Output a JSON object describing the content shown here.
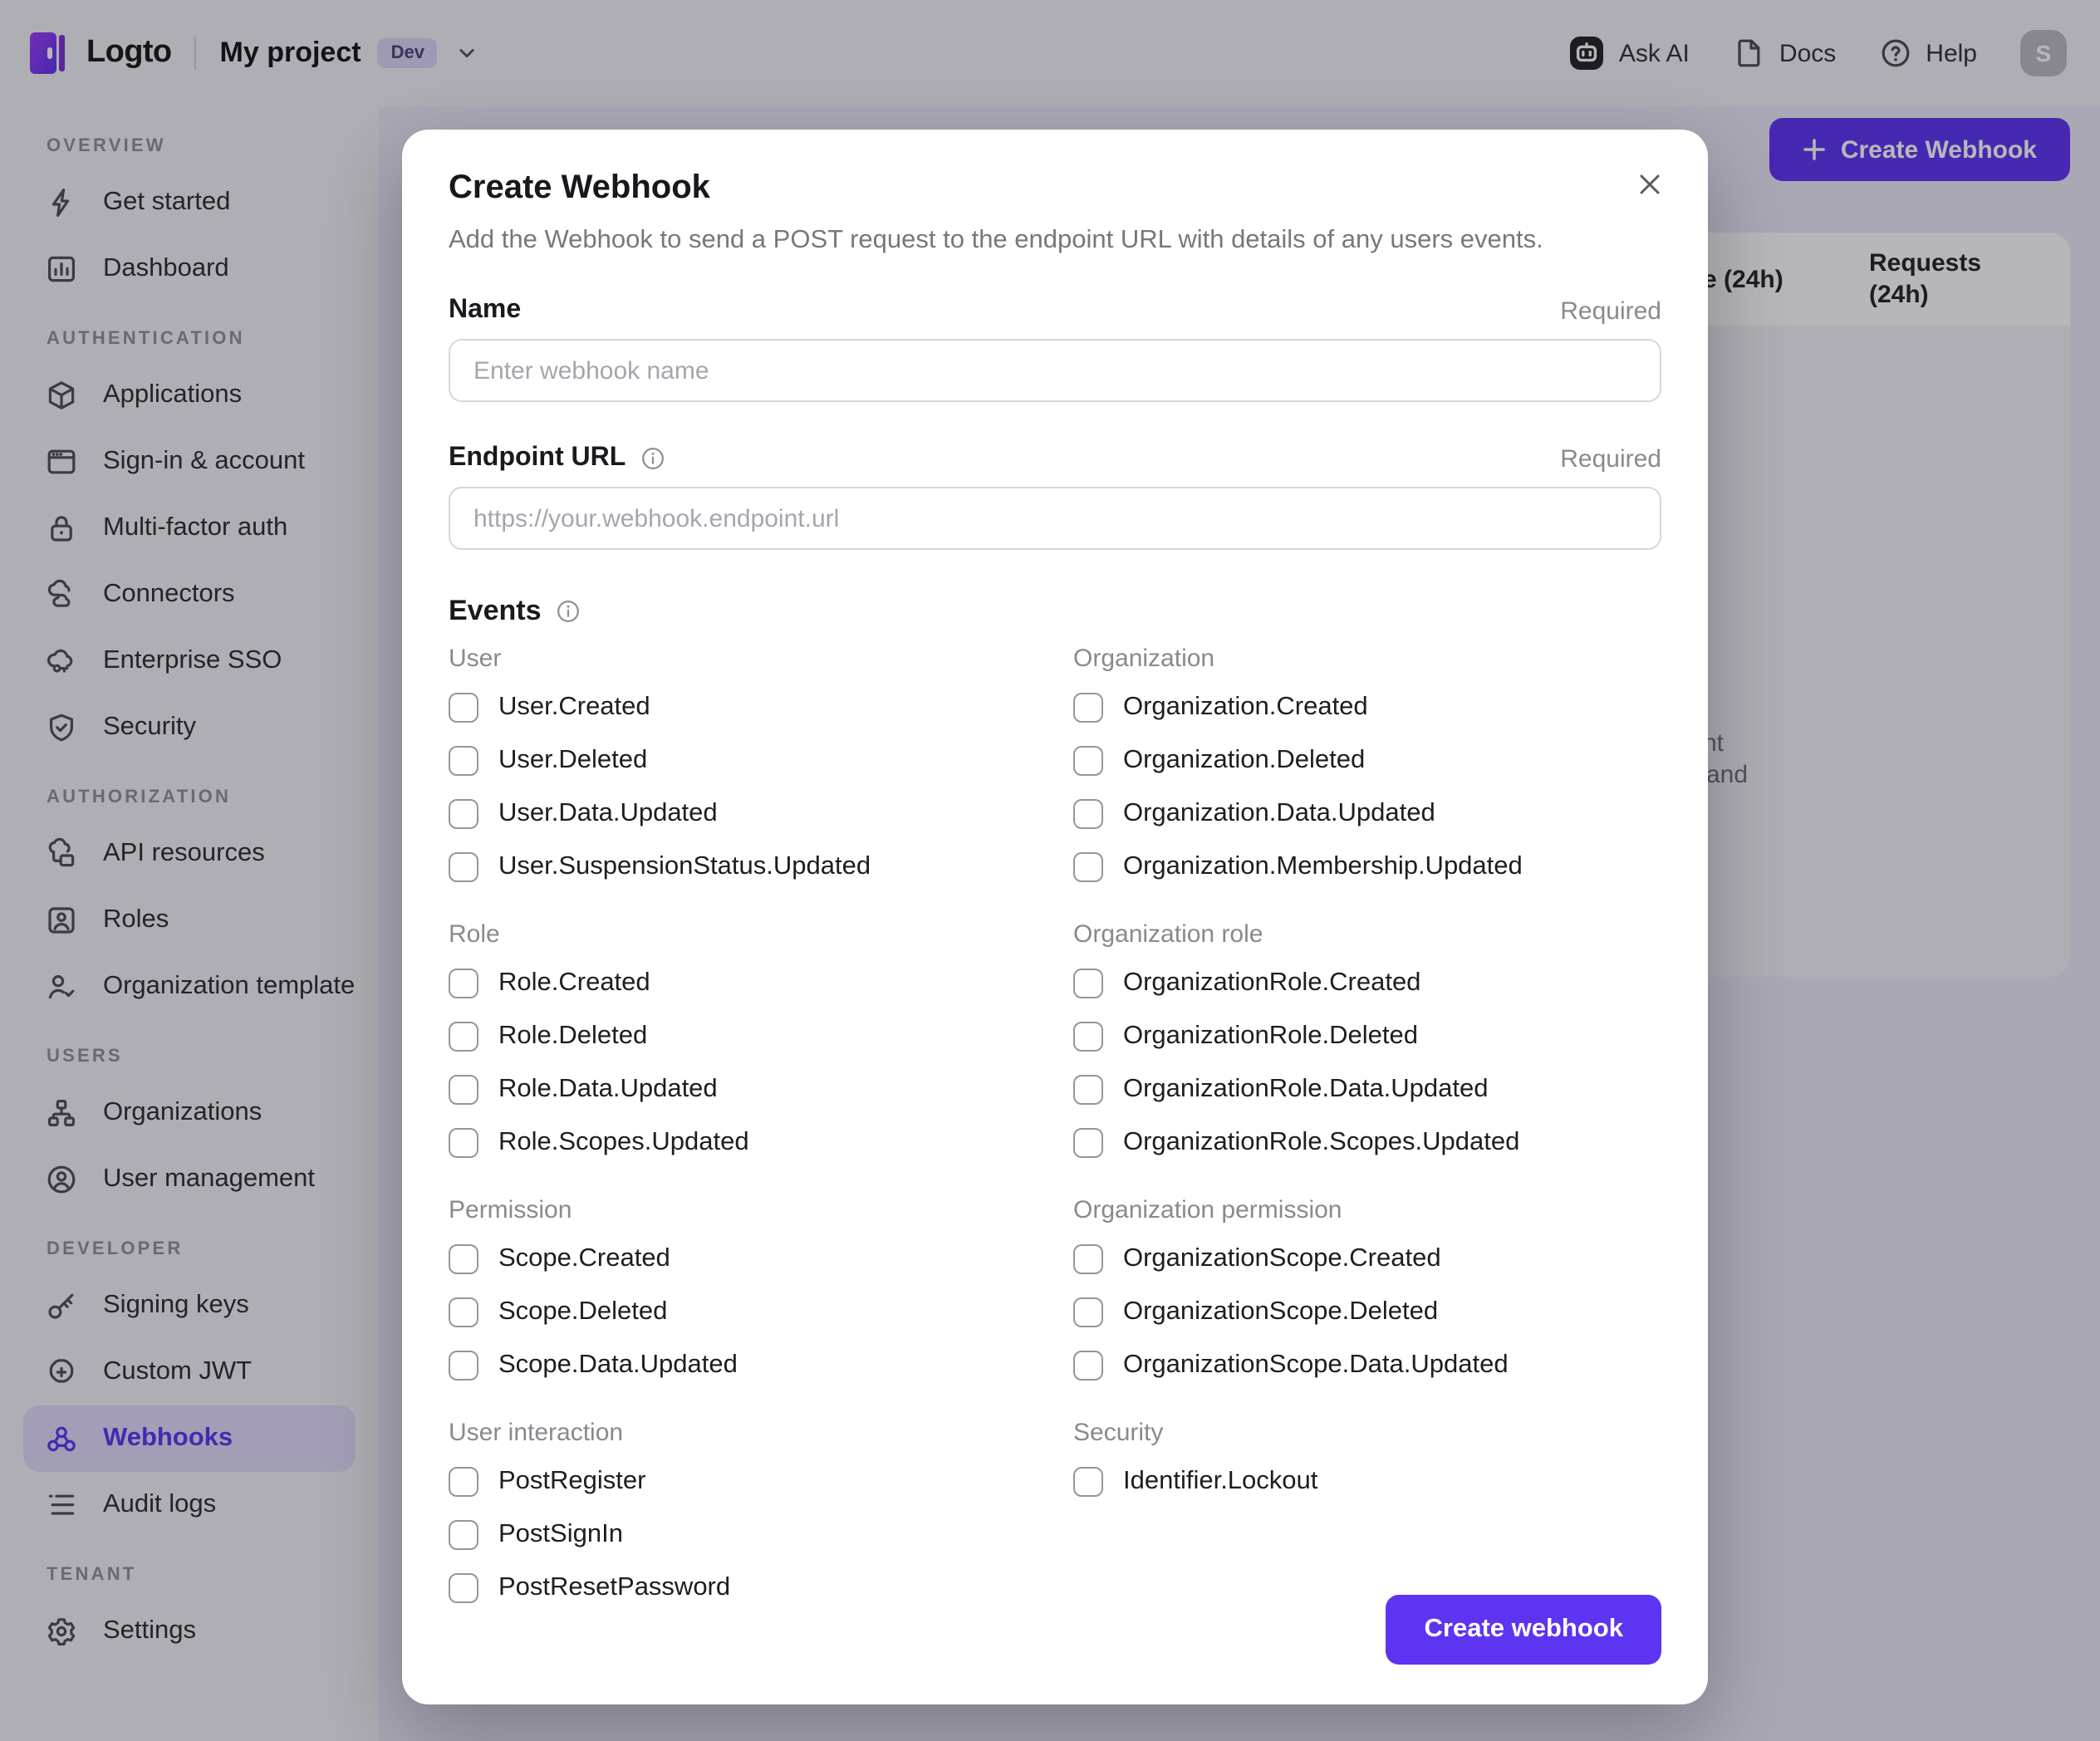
{
  "colors": {
    "accent": "#5d34f2",
    "sidebar_active_bg": "#e3dcf9",
    "backdrop": "rgba(18,15,26,0.30)"
  },
  "header": {
    "logo_text": "Logto",
    "project_name": "My project",
    "env_badge": "Dev",
    "actions": [
      {
        "label": "Ask AI"
      },
      {
        "label": "Docs"
      },
      {
        "label": "Help"
      }
    ],
    "avatar_initial": "S"
  },
  "sidebar": {
    "sections": [
      {
        "label": "OVERVIEW",
        "items": [
          {
            "label": "Get started",
            "icon": "lightning-icon"
          },
          {
            "label": "Dashboard",
            "icon": "bar-chart-icon"
          }
        ]
      },
      {
        "label": "AUTHENTICATION",
        "items": [
          {
            "label": "Applications",
            "icon": "cube-icon"
          },
          {
            "label": "Sign-in & account",
            "icon": "browser-window-icon"
          },
          {
            "label": "Multi-factor auth",
            "icon": "lock-icon"
          },
          {
            "label": "Connectors",
            "icon": "clouds-icon"
          },
          {
            "label": "Enterprise SSO",
            "icon": "cloud-key-icon"
          },
          {
            "label": "Security",
            "icon": "shield-check-icon"
          }
        ]
      },
      {
        "label": "AUTHORIZATION",
        "items": [
          {
            "label": "API resources",
            "icon": "cloud-stack-icon"
          },
          {
            "label": "Roles",
            "icon": "id-card-icon"
          },
          {
            "label": "Organization template",
            "icon": "user-check-icon"
          }
        ]
      },
      {
        "label": "USERS",
        "items": [
          {
            "label": "Organizations",
            "icon": "org-chart-icon"
          },
          {
            "label": "User management",
            "icon": "user-circle-icon"
          }
        ]
      },
      {
        "label": "DEVELOPER",
        "items": [
          {
            "label": "Signing keys",
            "icon": "key-icon"
          },
          {
            "label": "Custom JWT",
            "icon": "badge-plus-icon"
          },
          {
            "label": "Webhooks",
            "icon": "webhook-icon",
            "active": true
          },
          {
            "label": "Audit logs",
            "icon": "list-icon"
          }
        ]
      },
      {
        "label": "TENANT",
        "items": [
          {
            "label": "Settings",
            "icon": "gear-icon"
          }
        ]
      }
    ]
  },
  "background": {
    "create_webhook_label": "Create Webhook",
    "table": {
      "header_success_fragment": "e (24h)",
      "header_requests": "Requests (24h)"
    },
    "obscured_fragments": [
      "nt",
      "and"
    ]
  },
  "modal": {
    "title": "Create Webhook",
    "description": "Add the Webhook to send a POST request to the endpoint URL with details of any users events.",
    "fields": {
      "name": {
        "label": "Name",
        "required": "Required",
        "placeholder": "Enter webhook name"
      },
      "endpoint_url": {
        "label": "Endpoint URL",
        "required": "Required",
        "placeholder": "https://your.webhook.endpoint.url"
      }
    },
    "events": {
      "label": "Events",
      "groups": [
        {
          "label": "User",
          "items": [
            "User.Created",
            "User.Deleted",
            "User.Data.Updated",
            "User.SuspensionStatus.Updated"
          ]
        },
        {
          "label": "Organization",
          "items": [
            "Organization.Created",
            "Organization.Deleted",
            "Organization.Data.Updated",
            "Organization.Membership.Updated"
          ]
        },
        {
          "label": "Role",
          "items": [
            "Role.Created",
            "Role.Deleted",
            "Role.Data.Updated",
            "Role.Scopes.Updated"
          ]
        },
        {
          "label": "Organization role",
          "items": [
            "OrganizationRole.Created",
            "OrganizationRole.Deleted",
            "OrganizationRole.Data.Updated",
            "OrganizationRole.Scopes.Updated"
          ]
        },
        {
          "label": "Permission",
          "items": [
            "Scope.Created",
            "Scope.Deleted",
            "Scope.Data.Updated"
          ]
        },
        {
          "label": "Organization permission",
          "items": [
            "OrganizationScope.Created",
            "OrganizationScope.Deleted",
            "OrganizationScope.Data.Updated"
          ]
        },
        {
          "label": "User interaction",
          "items": [
            "PostRegister",
            "PostSignIn",
            "PostResetPassword"
          ]
        },
        {
          "label": "Security",
          "items": [
            "Identifier.Lockout"
          ]
        }
      ]
    },
    "submit_label": "Create webhook"
  }
}
